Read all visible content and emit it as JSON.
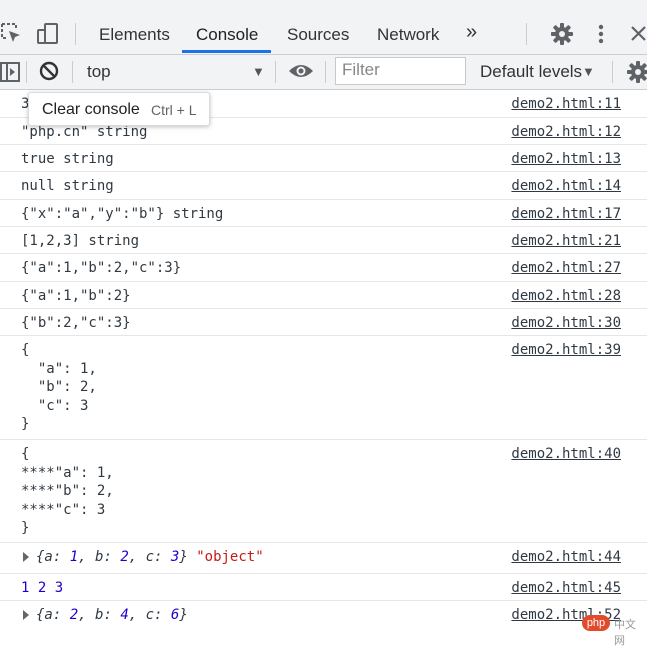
{
  "tabs": {
    "elements": "Elements",
    "console": "Console",
    "sources": "Sources",
    "network": "Network",
    "more": "»"
  },
  "toolbar": {
    "context": "top",
    "filter_placeholder": "Filter",
    "levels": "Default levels"
  },
  "tooltip": {
    "label": "Clear console",
    "shortcut": "Ctrl + L"
  },
  "logs": [
    {
      "text": "3",
      "source": "demo2.html:11"
    },
    {
      "text": "\"php.cn\" string",
      "source": "demo2.html:12"
    },
    {
      "text": "true string",
      "source": "demo2.html:13"
    },
    {
      "text": "null string",
      "source": "demo2.html:14"
    },
    {
      "text": "{\"x\":\"a\",\"y\":\"b\"} string",
      "source": "demo2.html:17"
    },
    {
      "text": "[1,2,3] string",
      "source": "demo2.html:21"
    },
    {
      "text": "{\"a\":1,\"b\":2,\"c\":3}",
      "source": "demo2.html:27"
    },
    {
      "text": "{\"a\":1,\"b\":2}",
      "source": "demo2.html:28"
    },
    {
      "text": "{\"b\":2,\"c\":3}",
      "source": "demo2.html:30"
    },
    {
      "text": "{\n  \"a\": 1,\n  \"b\": 2,\n  \"c\": 3\n}",
      "source": "demo2.html:39"
    },
    {
      "text": "{\n****\"a\": 1,\n****\"b\": 2,\n****\"c\": 3\n}",
      "source": "demo2.html:40"
    },
    {
      "obj_a": "1",
      "obj_b": "2",
      "obj_c": "3",
      "type_str": "\"object\"",
      "source": "demo2.html:44"
    },
    {
      "text": "1 2 3",
      "source": "demo2.html:45"
    },
    {
      "obj_a": "2",
      "obj_b": "4",
      "obj_c": "6",
      "source": "demo2.html:52"
    }
  ],
  "watermark": {
    "badge": "php",
    "text": "中文网"
  },
  "colors": {
    "accent": "#1a73e8",
    "number": "#1c00cf",
    "string": "#c41a16",
    "toolbar_bg": "#f1f3f4"
  }
}
